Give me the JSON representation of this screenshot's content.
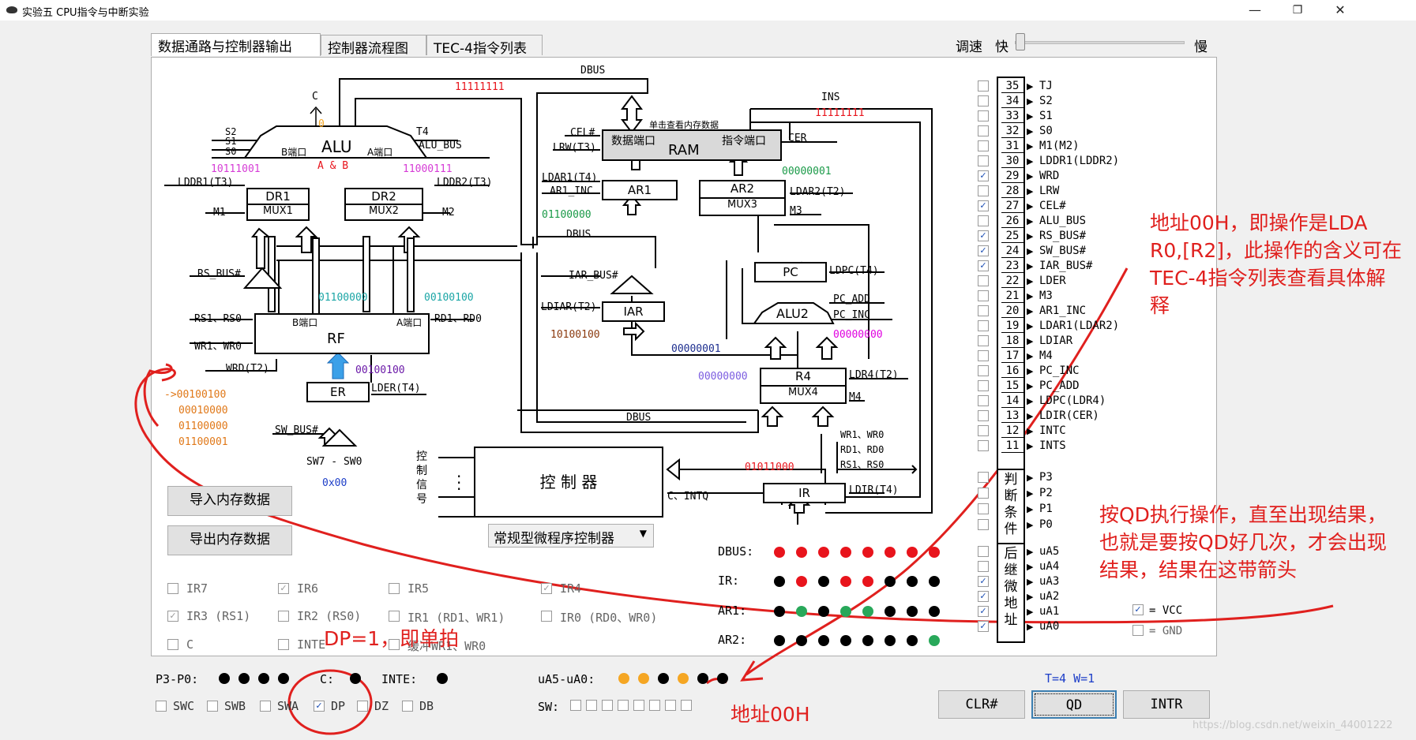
{
  "window": {
    "title": "实验五 CPU指令与中断实验"
  },
  "tabs": [
    {
      "label": "数据通路与控制器输出"
    },
    {
      "label": "控制器流程图"
    },
    {
      "label": "TEC-4指令列表"
    }
  ],
  "speed": {
    "label": "调速",
    "fast": "快",
    "slow": "慢"
  },
  "diagram": {
    "dbus": "DBUS",
    "ins": "INS",
    "c": "C",
    "c_val": "0",
    "bus_top_val": "11111111",
    "ins_val": "11111111",
    "alu": "ALU",
    "alu_b": "B端口",
    "alu_a": "A端口",
    "alu_op": "A & B",
    "s2": "S2",
    "s1": "S1",
    "s0": "S0",
    "t4": "T4",
    "alu_bus": "ALU_BUS",
    "alu_b_val": "10111001",
    "alu_a_val": "11000111",
    "lddr1": "LDDR1(T3)",
    "lddr2": "LDDR2(T3)",
    "dr1": "DR1",
    "mux1": "MUX1",
    "dr2": "DR2",
    "mux2": "MUX2",
    "m1": "M1",
    "m2": "M2",
    "rs_bus": "RS_BUS#",
    "rf_b_val": "01100000",
    "rf_a_val": "00100100",
    "rs1rs0": "RS1、RS0",
    "rd1rd0": "RD1、RD0",
    "wr1wr0": "WR1、WR0",
    "rf": "RF",
    "rf_b": "B端口",
    "rf_a": "A端口",
    "wrd": "WRD(T2)",
    "er_val": "00100100",
    "er": "ER",
    "lder": "LDER(T4)",
    "er_list": [
      "->00100100",
      "00010000",
      "01100000",
      "01100001"
    ],
    "sw_bus": "SW_BUS#",
    "sw": "SW7 - SW0",
    "sw_val": "0x00",
    "ram_note": "单击查看内存数据",
    "cel": "CEL#",
    "lrw": "LRW(T3)",
    "ram": "RAM",
    "ram_data": "数据端口",
    "ram_ins": "指令端口",
    "cer": "CER",
    "ldar1": "LDAR1(T4)",
    "ar1_inc": "AR1_INC",
    "ar1": "AR1",
    "ar1_val": "01100000",
    "dbus2": "DBUS",
    "ar2": "AR2",
    "mux3": "MUX3",
    "ldar2": "LDAR2(T2)",
    "m3": "M3",
    "ar2_val": "00000001",
    "iar_bus": "IAR_BUS#",
    "ldiar": "LDIAR(T2)",
    "iar": "IAR",
    "iar_val": "10100100",
    "pc": "PC",
    "ldpc": "LDPC(T4)",
    "pc_add": "PC_ADD",
    "pc_inc": "PC_INC",
    "alu2": "ALU2",
    "alu2_val": "00000000",
    "pc_val": "00000001",
    "r4": "R4",
    "mux4": "MUX4",
    "ldr4": "LDR4(T2)",
    "m4": "M4",
    "r4_val": "00000000",
    "dbus3": "DBUS",
    "ctrl_sig": "控制信号",
    "controller": "控 制 器",
    "c_intq": "C、INTQ",
    "ir_regs": "WR1、WR0",
    "ir_rd": "RD1、RD0",
    "ir_rs": "RS1、RS0",
    "ir": "IR",
    "ldir": "LDIR(T4)",
    "ir_val": "01011000"
  },
  "buttons": {
    "import": "导入内存数据",
    "export": "导出内存数据",
    "clr": "CLR#",
    "qd": "QD",
    "intr": "INTR"
  },
  "controller_select": "常规型微程序控制器",
  "ir_checks": [
    {
      "label": "IR7",
      "checked": false
    },
    {
      "label": "IR6",
      "checked": true
    },
    {
      "label": "IR5",
      "checked": false
    },
    {
      "label": "IR4",
      "checked": true
    },
    {
      "label": "IR3 (RS1)",
      "checked": true
    },
    {
      "label": "IR2 (RS0)",
      "checked": false
    },
    {
      "label": "IR1 (RD1、WR1)",
      "checked": false
    },
    {
      "label": "IR0 (RD0、WR0)",
      "checked": false
    },
    {
      "label": "C",
      "checked": false
    },
    {
      "label": "INTE",
      "checked": false
    },
    {
      "label": "缓冲WR1、WR0",
      "checked": false
    }
  ],
  "leds": {
    "dbus": {
      "label": "DBUS:",
      "colors": [
        "#e8141c",
        "#e8141c",
        "#e8141c",
        "#e8141c",
        "#e8141c",
        "#e8141c",
        "#e8141c",
        "#e8141c"
      ]
    },
    "ir": {
      "label": "IR:",
      "colors": [
        "#000",
        "#e8141c",
        "#000",
        "#e8141c",
        "#e8141c",
        "#000",
        "#000",
        "#000"
      ]
    },
    "ar1": {
      "label": "AR1:",
      "colors": [
        "#000",
        "#28a85a",
        "#000",
        "#28a85a",
        "#28a85a",
        "#000",
        "#000",
        "#000"
      ]
    },
    "ar2": {
      "label": "AR2:",
      "colors": [
        "#000",
        "#000",
        "#000",
        "#000",
        "#000",
        "#000",
        "#000",
        "#28a85a"
      ]
    }
  },
  "signals": [
    {
      "n": "35",
      "label": "TJ",
      "checked": false
    },
    {
      "n": "34",
      "label": "S2",
      "checked": false
    },
    {
      "n": "33",
      "label": "S1",
      "checked": false
    },
    {
      "n": "32",
      "label": "S0",
      "checked": false
    },
    {
      "n": "31",
      "label": "M1(M2)",
      "checked": false
    },
    {
      "n": "30",
      "label": "LDDR1(LDDR2)",
      "checked": false
    },
    {
      "n": "29",
      "label": "WRD",
      "checked": true
    },
    {
      "n": "28",
      "label": "LRW",
      "checked": false
    },
    {
      "n": "27",
      "label": "CEL#",
      "checked": true
    },
    {
      "n": "26",
      "label": "ALU_BUS",
      "checked": false
    },
    {
      "n": "25",
      "label": "RS_BUS#",
      "checked": true
    },
    {
      "n": "24",
      "label": "SW_BUS#",
      "checked": true
    },
    {
      "n": "23",
      "label": "IAR_BUS#",
      "checked": true
    },
    {
      "n": "22",
      "label": "LDER",
      "checked": false
    },
    {
      "n": "21",
      "label": "M3",
      "checked": false
    },
    {
      "n": "20",
      "label": "AR1_INC",
      "checked": false
    },
    {
      "n": "19",
      "label": "LDAR1(LDAR2)",
      "checked": false
    },
    {
      "n": "18",
      "label": "LDIAR",
      "checked": false
    },
    {
      "n": "17",
      "label": "M4",
      "checked": false
    },
    {
      "n": "16",
      "label": "PC_INC",
      "checked": false
    },
    {
      "n": "15",
      "label": "PC_ADD",
      "checked": false
    },
    {
      "n": "14",
      "label": "LDPC(LDR4)",
      "checked": false
    },
    {
      "n": "13",
      "label": "LDIR(CER)",
      "checked": false
    },
    {
      "n": "12",
      "label": "INTC",
      "checked": false
    },
    {
      "n": "11",
      "label": "INTS",
      "checked": false
    }
  ],
  "judge": {
    "label": "判断条件",
    "items": [
      "P3",
      "P2",
      "P1",
      "P0"
    ]
  },
  "next_addr": {
    "label": "后继微地址",
    "items": [
      {
        "label": "uA5",
        "checked": false
      },
      {
        "label": "uA4",
        "checked": false
      },
      {
        "label": "uA3",
        "checked": true
      },
      {
        "label": "uA2",
        "checked": true
      },
      {
        "label": "uA1",
        "checked": true
      },
      {
        "label": "uA0",
        "checked": true
      }
    ]
  },
  "vcc": {
    "label": "= VCC",
    "gnd": "= GND"
  },
  "status": {
    "p3p0": "P3-P0:",
    "c": "C:",
    "inte": "INTE:",
    "ua": "uA5-uA0:",
    "sw": "SW:",
    "tw": "T=4 W=1"
  },
  "ua_leds": [
    "#f5a623",
    "#f5a623",
    "#000",
    "#f5a623",
    "#000",
    "#000"
  ],
  "bottom_checks": [
    {
      "label": "SWC",
      "checked": false
    },
    {
      "label": "SWB",
      "checked": false
    },
    {
      "label": "SWA",
      "checked": false
    },
    {
      "label": "DP",
      "checked": true
    },
    {
      "label": "DZ",
      "checked": false
    },
    {
      "label": "DB",
      "checked": false
    }
  ],
  "annotations": {
    "lda": "地址00H，即操作是LDA R0,[R2]，此操作的含义可在TEC-4指令列表查看具体解释",
    "qd": "按QD执行操作，直至出现结果，也就是要按QD好几次，才会出现结果，结果在这带箭头",
    "dp": "DP=1，即单拍",
    "addr": "地址00H"
  },
  "watermark": "https://blog.csdn.net/weixin_44001222"
}
